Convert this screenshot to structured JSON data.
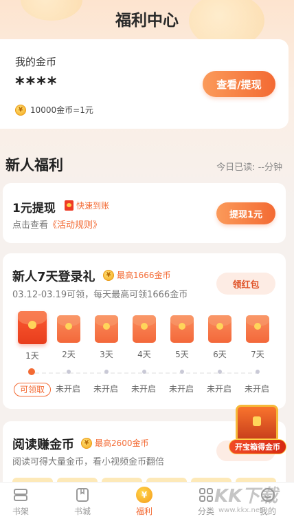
{
  "header": {
    "title": "福利中心"
  },
  "gold": {
    "label": "我的金币",
    "value": "****",
    "rate": "10000金币=1元",
    "view_button": "查看/提现"
  },
  "newbie": {
    "section_title": "新人福利",
    "today_read": "今日已读: --分钟"
  },
  "withdraw": {
    "title": "1元提现",
    "tag": "快速到账",
    "desc_prefix": "点击查看",
    "desc_link": "《活动规则》",
    "button": "提现1元"
  },
  "login_gift": {
    "title": "新人7天登录礼",
    "badge": "最高1666金币",
    "desc": "03.12-03.19可领，每天最高可领1666金币",
    "button": "领红包",
    "days": [
      {
        "label": "1天",
        "state": "可领取"
      },
      {
        "label": "2天",
        "state": "未开启"
      },
      {
        "label": "3天",
        "state": "未开启"
      },
      {
        "label": "4天",
        "state": "未开启"
      },
      {
        "label": "5天",
        "state": "未开启"
      },
      {
        "label": "6天",
        "state": "未开启"
      },
      {
        "label": "7天",
        "state": "未开启"
      }
    ]
  },
  "read_earn": {
    "title": "阅读赚金币",
    "badge": "最高2600金币",
    "desc": "阅读可得大量金币，看小视频金币翻倍"
  },
  "treasure": {
    "label": "开宝箱得金币"
  },
  "tabbar": {
    "items": [
      {
        "label": "书架"
      },
      {
        "label": "书城"
      },
      {
        "label": "福利"
      },
      {
        "label": "分类"
      },
      {
        "label": "我的"
      }
    ]
  },
  "watermark": {
    "text": "KK下载",
    "url": "www.kkx.net"
  }
}
